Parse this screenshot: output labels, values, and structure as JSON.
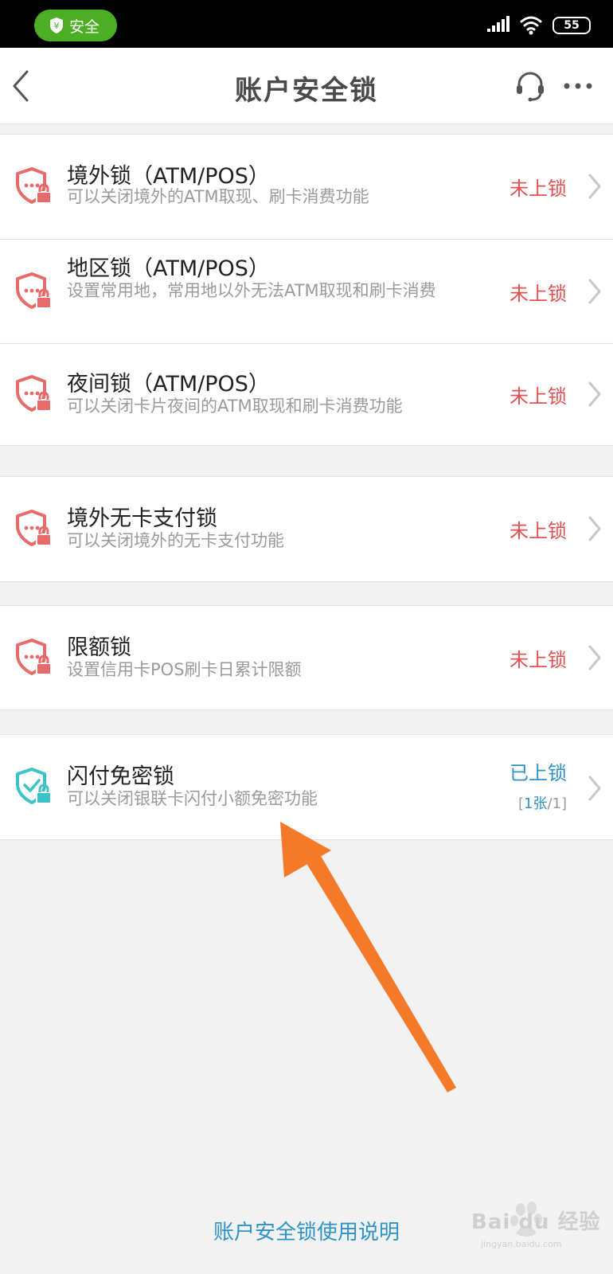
{
  "status_bar": {
    "safe_label": "安全",
    "battery": "55"
  },
  "nav": {
    "title": "账户安全锁"
  },
  "items": [
    {
      "title": "境外锁（ATM/POS）",
      "desc": "可以关闭境外的ATM取现、刷卡消费功能",
      "status": "未上锁"
    },
    {
      "title": "地区锁（ATM/POS）",
      "desc": "设置常用地，常用地以外无法ATM取现和刷卡消费",
      "status": "未上锁"
    },
    {
      "title": "夜间锁（ATM/POS）",
      "desc": "可以关闭卡片夜间的ATM取现和刷卡消费功能",
      "status": "未上锁"
    },
    {
      "title": "境外无卡支付锁",
      "desc": "可以关闭境外的无卡支付功能",
      "status": "未上锁"
    },
    {
      "title": "限额锁",
      "desc": "设置信用卡POS刷卡日累计限额",
      "status": "未上锁"
    },
    {
      "title": "闪付免密锁",
      "desc": "可以关闭银联卡闪付小额免密功能",
      "status": "已上锁",
      "count_open": "[",
      "count_num": "1张",
      "count_close": "/1]"
    }
  ],
  "footer": {
    "link": "账户安全锁使用说明"
  },
  "watermark": {
    "text": "Bai du 经验",
    "sub": "jingyan.baidu.com"
  },
  "colors": {
    "unlocked": "#e35050",
    "locked": "#2d93c7",
    "locked_icon": "#3cc3c8",
    "unlocked_icon": "#e86a6a",
    "safe_pill": "#4caf23",
    "arrow": "#f47a2a"
  }
}
